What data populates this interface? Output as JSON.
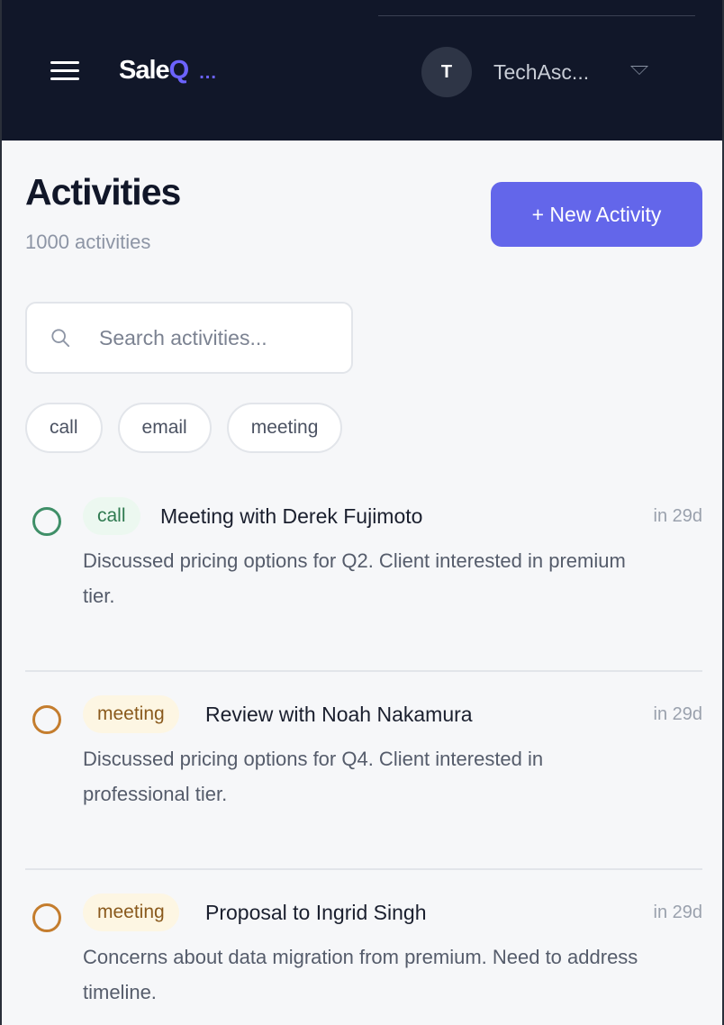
{
  "header": {
    "logo_main": "Sale",
    "logo_accent": "Q",
    "logo_dots": "...",
    "avatar_initial": "T",
    "username": "TechAsc...",
    "colors": {
      "background": "#111729",
      "accent": "#6c63ff"
    }
  },
  "page": {
    "title": "Activities",
    "subtitle": "1000 activities",
    "new_button_label": "+ New Activity"
  },
  "search": {
    "placeholder": "Search activities...",
    "value": "",
    "icon": "search-icon"
  },
  "filters": [
    "call",
    "email",
    "meeting"
  ],
  "activities": [
    {
      "type": "call",
      "title": "Meeting with Derek Fujimoto",
      "time": "in 29d",
      "description": "Discussed pricing options for Q2. Client interested in premium tier.",
      "ring_color": "#3f8f68"
    },
    {
      "type": "meeting",
      "title": "Review with Noah Nakamura",
      "time": "in 29d",
      "description": "Discussed pricing options for Q4. Client interested in professional tier.",
      "ring_color": "#c47d2e"
    },
    {
      "type": "meeting",
      "title": "Proposal to Ingrid Singh",
      "time": "in 29d",
      "description": "Concerns about data migration from premium. Need to address timeline.",
      "ring_color": "#c47d2e"
    }
  ]
}
